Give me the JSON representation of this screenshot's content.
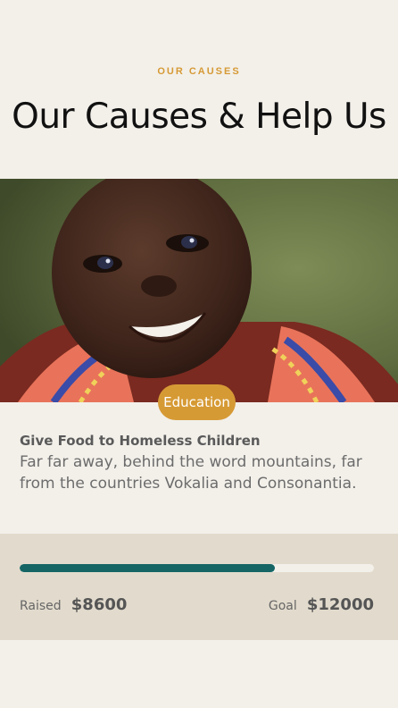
{
  "header": {
    "eyebrow": "OUR CAUSES",
    "title": "Our Causes & Help Us"
  },
  "cause": {
    "category": "Education",
    "title": "Give Food to Homeless Children",
    "description": "Far far away, behind the word mountains, far from the countries Vokalia and Consonantia.",
    "raised_label": "Raised",
    "raised_amount": "$8600",
    "goal_label": "Goal",
    "goal_amount": "$12000",
    "progress": 0.72
  },
  "colors": {
    "accent": "#d69a35",
    "progress": "#156565",
    "background": "#f3f0ea",
    "panel": "#e2dbcd"
  }
}
